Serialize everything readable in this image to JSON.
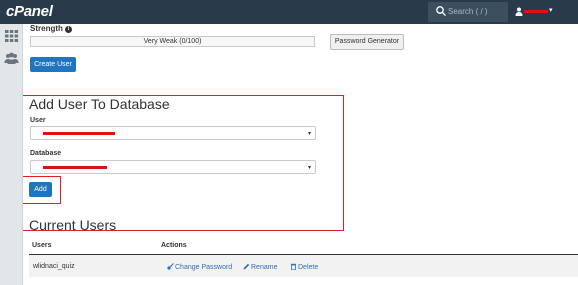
{
  "topbar": {
    "logo": "cPanel",
    "search_placeholder": "Search ( / )",
    "caret": "▾"
  },
  "password": {
    "strength_label": "Strength",
    "strength_meter_text": "Very Weak (0/100)",
    "generator_button": "Password Generator",
    "create_user_button": "Create User"
  },
  "add_user_to_db": {
    "title": "Add User To Database",
    "user_label": "User",
    "database_label": "Database",
    "add_button": "Add"
  },
  "current_users": {
    "title": "Current Users",
    "columns": [
      "Users",
      "Actions"
    ],
    "rows": [
      {
        "user": "wlidnaci_quiz",
        "actions": [
          "Change Password",
          "Rename",
          "Delete"
        ]
      }
    ]
  },
  "colors": {
    "topbar": "#293a4a",
    "primary": "#1f75be",
    "link": "#2b6fb5",
    "highlight": "#e02020",
    "redaction": "#e01010"
  },
  "icons": [
    "search-icon",
    "user-icon",
    "grid-icon",
    "users-icon",
    "info-icon",
    "pencil-icon",
    "trash-icon"
  ]
}
